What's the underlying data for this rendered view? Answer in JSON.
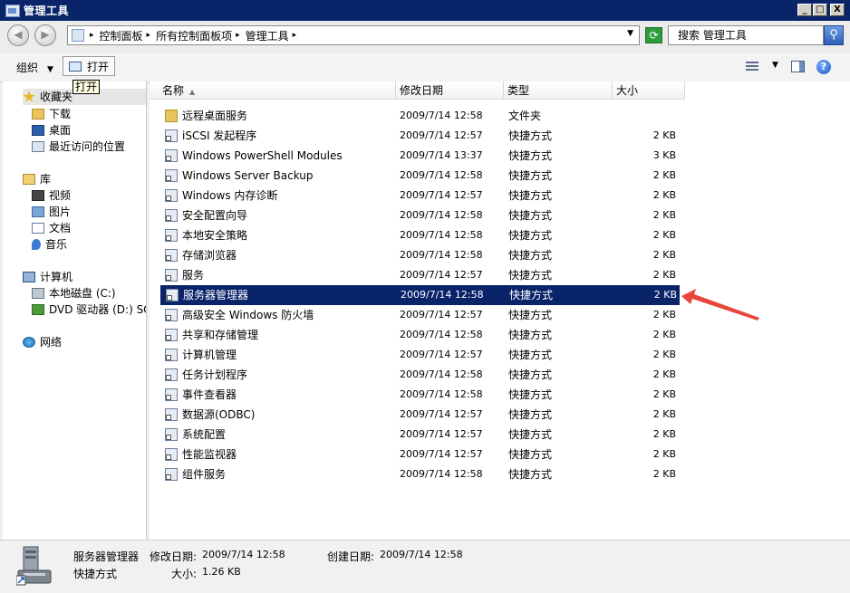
{
  "window": {
    "title": "管理工具"
  },
  "window_buttons": {
    "minimize": "_",
    "maximize": "□",
    "close": "X"
  },
  "address": {
    "breadcrumbs": [
      "控制面板",
      "所有控制面板项",
      "管理工具"
    ],
    "search_placeholder": "搜索 管理工具"
  },
  "toolbar": {
    "organize_label": "组织",
    "open_label": "打开",
    "tooltip": "打开"
  },
  "nav": {
    "favorites": {
      "label": "收藏夹",
      "items": [
        "下载",
        "桌面",
        "最近访问的位置"
      ]
    },
    "libraries": {
      "label": "库",
      "items": [
        "视频",
        "图片",
        "文档",
        "音乐"
      ]
    },
    "computer": {
      "label": "计算机",
      "items": [
        "本地磁盘 (C:)",
        "DVD 驱动器 (D:) SQ"
      ]
    },
    "network": {
      "label": "网络"
    }
  },
  "columns": {
    "name": "名称",
    "date": "修改日期",
    "type": "类型",
    "size": "大小"
  },
  "files": [
    {
      "name": "远程桌面服务",
      "date": "2009/7/14 12:58",
      "type": "文件夹",
      "size": "",
      "icon": "folder-icon"
    },
    {
      "name": "iSCSI 发起程序",
      "date": "2009/7/14 12:57",
      "type": "快捷方式",
      "size": "2 KB",
      "icon": "shortcut-icon"
    },
    {
      "name": "Windows PowerShell Modules",
      "date": "2009/7/14 13:37",
      "type": "快捷方式",
      "size": "3 KB",
      "icon": "shortcut-icon"
    },
    {
      "name": "Windows Server Backup",
      "date": "2009/7/14 12:58",
      "type": "快捷方式",
      "size": "2 KB",
      "icon": "shortcut-icon"
    },
    {
      "name": "Windows 内存诊断",
      "date": "2009/7/14 12:57",
      "type": "快捷方式",
      "size": "2 KB",
      "icon": "shortcut-icon"
    },
    {
      "name": "安全配置向导",
      "date": "2009/7/14 12:58",
      "type": "快捷方式",
      "size": "2 KB",
      "icon": "shortcut-icon"
    },
    {
      "name": "本地安全策略",
      "date": "2009/7/14 12:58",
      "type": "快捷方式",
      "size": "2 KB",
      "icon": "shortcut-icon"
    },
    {
      "name": "存储浏览器",
      "date": "2009/7/14 12:58",
      "type": "快捷方式",
      "size": "2 KB",
      "icon": "shortcut-icon"
    },
    {
      "name": "服务",
      "date": "2009/7/14 12:57",
      "type": "快捷方式",
      "size": "2 KB",
      "icon": "shortcut-icon"
    },
    {
      "name": "服务器管理器",
      "date": "2009/7/14 12:58",
      "type": "快捷方式",
      "size": "2 KB",
      "icon": "shortcut-icon",
      "selected": true
    },
    {
      "name": "高级安全 Windows 防火墙",
      "date": "2009/7/14 12:57",
      "type": "快捷方式",
      "size": "2 KB",
      "icon": "shortcut-icon"
    },
    {
      "name": "共享和存储管理",
      "date": "2009/7/14 12:58",
      "type": "快捷方式",
      "size": "2 KB",
      "icon": "shortcut-icon"
    },
    {
      "name": "计算机管理",
      "date": "2009/7/14 12:57",
      "type": "快捷方式",
      "size": "2 KB",
      "icon": "shortcut-icon"
    },
    {
      "name": "任务计划程序",
      "date": "2009/7/14 12:58",
      "type": "快捷方式",
      "size": "2 KB",
      "icon": "shortcut-icon"
    },
    {
      "name": "事件查看器",
      "date": "2009/7/14 12:58",
      "type": "快捷方式",
      "size": "2 KB",
      "icon": "shortcut-icon"
    },
    {
      "name": "数据源(ODBC)",
      "date": "2009/7/14 12:57",
      "type": "快捷方式",
      "size": "2 KB",
      "icon": "shortcut-icon"
    },
    {
      "name": "系统配置",
      "date": "2009/7/14 12:57",
      "type": "快捷方式",
      "size": "2 KB",
      "icon": "shortcut-icon"
    },
    {
      "name": "性能监视器",
      "date": "2009/7/14 12:57",
      "type": "快捷方式",
      "size": "2 KB",
      "icon": "shortcut-icon"
    },
    {
      "name": "组件服务",
      "date": "2009/7/14 12:58",
      "type": "快捷方式",
      "size": "2 KB",
      "icon": "shortcut-icon"
    }
  ],
  "details": {
    "name": "服务器管理器",
    "modified_label": "修改日期:",
    "modified": "2009/7/14 12:58",
    "created_label": "创建日期:",
    "created": "2009/7/14 12:58",
    "type": "快捷方式",
    "size_label": "大小:",
    "size": "1.26 KB"
  },
  "colors": {
    "selection": "#0a246a",
    "annotation_arrow": "#e8463a"
  }
}
